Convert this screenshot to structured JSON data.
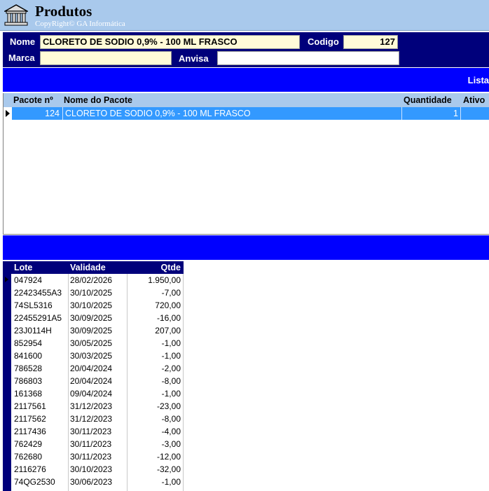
{
  "window": {
    "title": "Produtos",
    "copyright": "CopyRight© GA Informática"
  },
  "form": {
    "nome_label": "Nome",
    "nome_value": "CLORETO DE SODIO 0,9% - 100 ML FRASCO",
    "codigo_label": "Codigo",
    "codigo_value": "127",
    "marca_label": "Marca",
    "marca_value": "",
    "anvisa_label": "Anvisa",
    "anvisa_value": ""
  },
  "band": {
    "lista_label": "Lista"
  },
  "packages": {
    "headers": {
      "pacote": "Pacote nº",
      "nome": "Nome do Pacote",
      "quantidade": "Quantidade",
      "ativo": "Ativo"
    },
    "rows": [
      {
        "pacote": "124",
        "nome": "CLORETO DE SODIO 0,9% - 100 ML FRASCO",
        "quantidade": "1",
        "ativo": ""
      }
    ]
  },
  "lots": {
    "headers": {
      "lote": "Lote",
      "validade": "Validade",
      "qtde": "Qtde"
    },
    "rows": [
      {
        "lote": "047924",
        "validade": "28/02/2026",
        "qtde": "1.950,00"
      },
      {
        "lote": "22423455A3",
        "validade": "30/10/2025",
        "qtde": "-7,00"
      },
      {
        "lote": "74SL5316",
        "validade": "30/10/2025",
        "qtde": "720,00"
      },
      {
        "lote": "22455291A5",
        "validade": "30/09/2025",
        "qtde": "-16,00"
      },
      {
        "lote": "23J0114H",
        "validade": "30/09/2025",
        "qtde": "207,00"
      },
      {
        "lote": "852954",
        "validade": "30/05/2025",
        "qtde": "-1,00"
      },
      {
        "lote": "841600",
        "validade": "30/03/2025",
        "qtde": "-1,00"
      },
      {
        "lote": "786528",
        "validade": "20/04/2024",
        "qtde": "-2,00"
      },
      {
        "lote": "786803",
        "validade": "20/04/2024",
        "qtde": "-8,00"
      },
      {
        "lote": "161368",
        "validade": "09/04/2024",
        "qtde": "-1,00"
      },
      {
        "lote": "2117561",
        "validade": "31/12/2023",
        "qtde": "-23,00"
      },
      {
        "lote": "2117562",
        "validade": "31/12/2023",
        "qtde": "-8,00"
      },
      {
        "lote": "2117436",
        "validade": "30/11/2023",
        "qtde": "-4,00"
      },
      {
        "lote": "762429",
        "validade": "30/11/2023",
        "qtde": "-3,00"
      },
      {
        "lote": "762680",
        "validade": "30/11/2023",
        "qtde": "-12,00"
      },
      {
        "lote": "2116276",
        "validade": "30/10/2023",
        "qtde": "-32,00"
      },
      {
        "lote": "74QG2530",
        "validade": "30/06/2023",
        "qtde": "-1,00"
      }
    ]
  },
  "colors": {
    "titlebar": "#a9c9ec",
    "navy": "#00007b",
    "band_blue": "#0000ff",
    "selection": "#3399ff",
    "field_yellow": "#fffbd8"
  }
}
